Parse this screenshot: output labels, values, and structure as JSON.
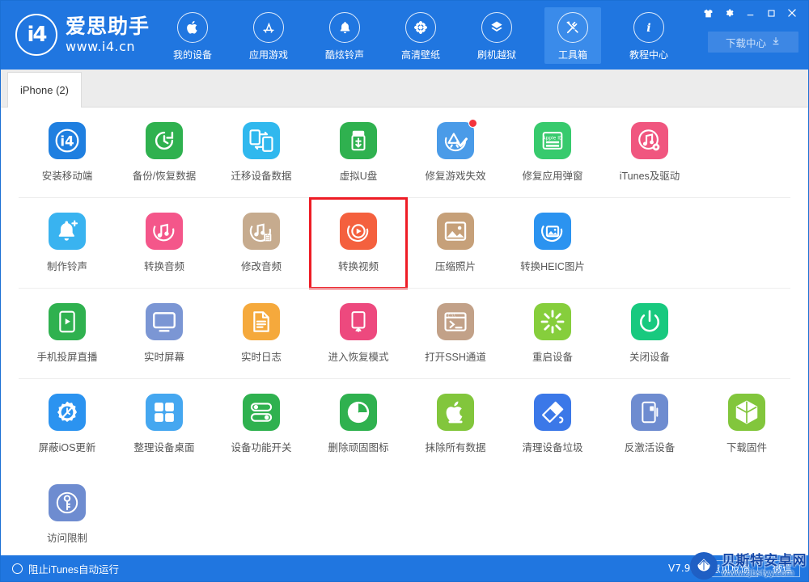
{
  "app": {
    "brand_name": "爱思助手",
    "brand_url": "www.i4.cn",
    "logo_text": "i4"
  },
  "header": {
    "nav_items": [
      {
        "label": "我的设备",
        "icon": "apple-icon",
        "active": false
      },
      {
        "label": "应用游戏",
        "icon": "appstore-icon",
        "active": false
      },
      {
        "label": "酷炫铃声",
        "icon": "bell-icon",
        "active": false
      },
      {
        "label": "高清壁纸",
        "icon": "flower-icon",
        "active": false
      },
      {
        "label": "刷机越狱",
        "icon": "box-icon",
        "active": false
      },
      {
        "label": "工具箱",
        "icon": "tools-icon",
        "active": true
      },
      {
        "label": "教程中心",
        "icon": "info-icon",
        "active": false
      }
    ],
    "window_controls": [
      {
        "name": "skin-icon",
        "glyph": "skin"
      },
      {
        "name": "settings-gear-icon",
        "glyph": "gear"
      },
      {
        "name": "minimize-icon",
        "glyph": "minimize"
      },
      {
        "name": "maximize-icon",
        "glyph": "maximize"
      },
      {
        "name": "close-icon",
        "glyph": "close"
      }
    ],
    "download_center_label": "下载中心"
  },
  "tabs": [
    {
      "label": "iPhone (2)",
      "active": true
    }
  ],
  "toolbox": {
    "rows": [
      {
        "separator": true,
        "tiles": [
          {
            "label": "安装移动端",
            "icon": "i4-app-icon",
            "color": "#1f7fe0",
            "badge": false,
            "highlighted": false
          },
          {
            "label": "备份/恢复数据",
            "icon": "backup-restore-icon",
            "color": "#2fb14f",
            "badge": false,
            "highlighted": false
          },
          {
            "label": "迁移设备数据",
            "icon": "migrate-data-icon",
            "color": "#30b8ee",
            "badge": false,
            "highlighted": false
          },
          {
            "label": "虚拟U盘",
            "icon": "usb-drive-icon",
            "color": "#2fb14f",
            "badge": false,
            "highlighted": false
          },
          {
            "label": "修复游戏失效",
            "icon": "fix-game-icon",
            "color": "#4a9be8",
            "badge": true,
            "highlighted": false
          },
          {
            "label": "修复应用弹窗",
            "icon": "apple-id-icon",
            "color": "#37ca6d",
            "badge": false,
            "highlighted": false
          },
          {
            "label": "iTunes及驱动",
            "icon": "itunes-driver-icon",
            "color": "#f0567f",
            "badge": false,
            "highlighted": false
          }
        ]
      },
      {
        "separator": true,
        "tiles": [
          {
            "label": "制作铃声",
            "icon": "make-ringtone-icon",
            "color": "#39b3f0",
            "badge": false,
            "highlighted": false
          },
          {
            "label": "转换音频",
            "icon": "convert-audio-icon",
            "color": "#f4568a",
            "badge": false,
            "highlighted": false
          },
          {
            "label": "修改音频",
            "icon": "edit-audio-icon",
            "color": "#c6ab8e",
            "badge": false,
            "highlighted": false
          },
          {
            "label": "转换视频",
            "icon": "convert-video-icon",
            "color": "#f4603e",
            "badge": false,
            "highlighted": true
          },
          {
            "label": "压缩照片",
            "icon": "compress-photo-icon",
            "color": "#c6a079",
            "badge": false,
            "highlighted": false
          },
          {
            "label": "转换HEIC图片",
            "icon": "convert-heic-icon",
            "color": "#2b93f0",
            "badge": false,
            "highlighted": false
          }
        ]
      },
      {
        "separator": true,
        "tiles": [
          {
            "label": "手机投屏直播",
            "icon": "screen-cast-icon",
            "color": "#2fb14f",
            "badge": false,
            "highlighted": false
          },
          {
            "label": "实时屏幕",
            "icon": "realtime-screen-icon",
            "color": "#7b96d4",
            "badge": false,
            "highlighted": false
          },
          {
            "label": "实时日志",
            "icon": "realtime-log-icon",
            "color": "#f5a93c",
            "badge": false,
            "highlighted": false
          },
          {
            "label": "进入恢复模式",
            "icon": "recovery-mode-icon",
            "color": "#ed497e",
            "badge": false,
            "highlighted": false
          },
          {
            "label": "打开SSH通道",
            "icon": "ssh-tunnel-icon",
            "color": "#c2a188",
            "badge": false,
            "highlighted": false
          },
          {
            "label": "重启设备",
            "icon": "restart-device-icon",
            "color": "#86ce3c",
            "badge": false,
            "highlighted": false
          },
          {
            "label": "关闭设备",
            "icon": "shutdown-device-icon",
            "color": "#18c97f",
            "badge": false,
            "highlighted": false
          }
        ]
      },
      {
        "separator": false,
        "tiles": [
          {
            "label": "屏蔽iOS更新",
            "icon": "block-ios-update-icon",
            "color": "#2b93f0",
            "badge": false,
            "highlighted": false
          },
          {
            "label": "整理设备桌面",
            "icon": "arrange-desktop-icon",
            "color": "#45a7f0",
            "badge": false,
            "highlighted": false
          },
          {
            "label": "设备功能开关",
            "icon": "feature-switch-icon",
            "color": "#2fb14f",
            "badge": false,
            "highlighted": false
          },
          {
            "label": "删除顽固图标",
            "icon": "delete-icon-icon",
            "color": "#2fb14f",
            "badge": false,
            "highlighted": false
          },
          {
            "label": "抹除所有数据",
            "icon": "erase-data-icon",
            "color": "#82c63c",
            "badge": false,
            "highlighted": false
          },
          {
            "label": "清理设备垃圾",
            "icon": "clean-junk-icon",
            "color": "#3b78e8",
            "badge": false,
            "highlighted": false
          },
          {
            "label": "反激活设备",
            "icon": "deactivate-device-icon",
            "color": "#6e8cd0",
            "badge": false,
            "highlighted": false
          },
          {
            "label": "下载固件",
            "icon": "download-firmware-icon",
            "color": "#82c63c",
            "badge": false,
            "highlighted": false
          }
        ]
      },
      {
        "separator": false,
        "tiles": [
          {
            "label": "访问限制",
            "icon": "access-restriction-icon",
            "color": "#6e8cd0",
            "badge": false,
            "highlighted": false
          }
        ]
      }
    ]
  },
  "footer": {
    "block_itunes_label": "阻止iTunes自动运行",
    "version": "V7.93",
    "feedback_label": "意见反馈",
    "wechat_label": "微信"
  },
  "watermark": {
    "title": "贝斯特安卓网",
    "url": "www.zjbstyy.com"
  },
  "colors": {
    "header_blue": "#2076e0",
    "nav_active": "#3a8bea",
    "highlight_red": "#ee1c25",
    "badge_red": "#f4333c"
  }
}
